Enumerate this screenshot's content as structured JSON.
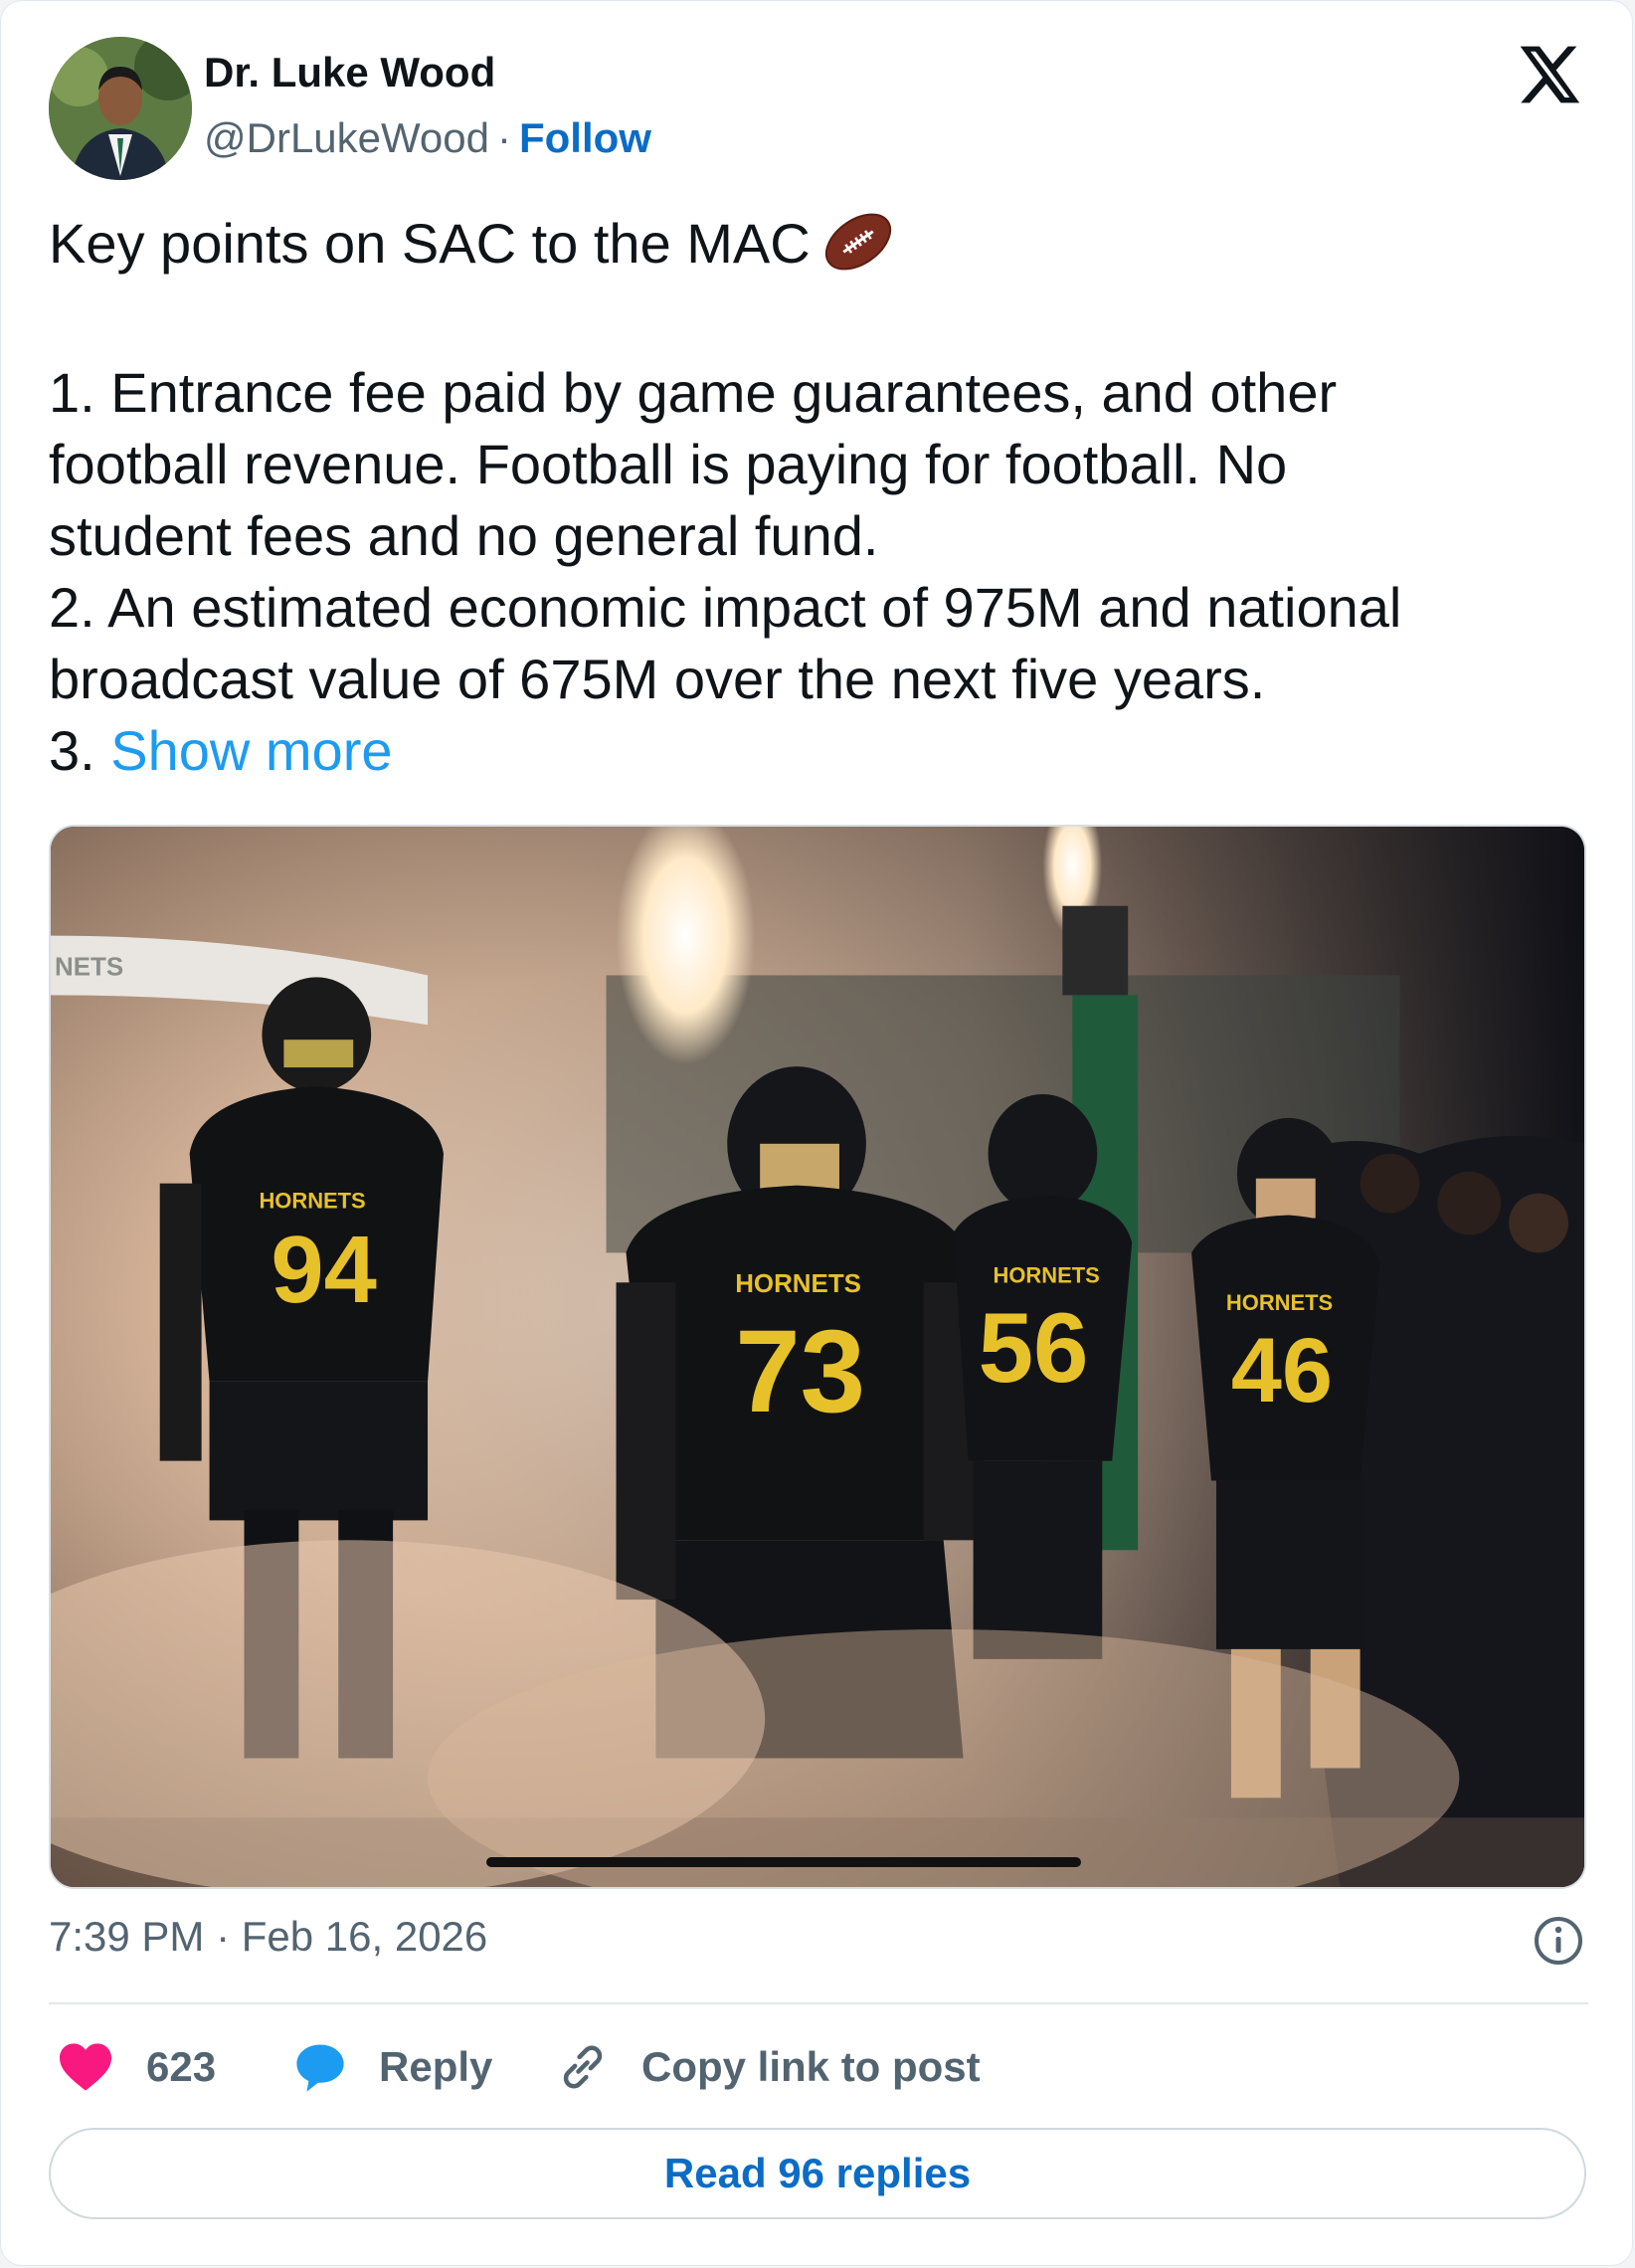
{
  "author": {
    "name": "Dr. Luke Wood",
    "handle": "@DrLukeWood",
    "separator": "·",
    "follow_label": "Follow"
  },
  "tweet": {
    "line1": "Key points on SAC to the MAC",
    "line2": "1. Entrance fee paid by game guarantees, and other",
    "line3": "football revenue. Football is paying for football. No",
    "line4": "student fees and no general fund.",
    "line5": "2. An estimated economic impact of 975M and national",
    "line6": "broadcast value of 675M over the next five years.",
    "line7_prefix": "3. ",
    "show_more": "Show more"
  },
  "media": {
    "banner_text": "NETS",
    "players": [
      {
        "team": "HORNETS",
        "number": "94"
      },
      {
        "team": "HORNETS",
        "number": "73"
      },
      {
        "team": "HORNETS",
        "number": "56"
      },
      {
        "team": "HORNETS",
        "number": "46"
      }
    ]
  },
  "meta": {
    "timestamp": "7:39 PM · Feb 16, 2026"
  },
  "actions": {
    "like_count": "623",
    "reply_label": "Reply",
    "copy_label": "Copy link to post"
  },
  "footer": {
    "read_replies": "Read 96 replies"
  },
  "colors": {
    "accent": "#0b6cc6",
    "link": "#1d9bf0",
    "like": "#f91880",
    "reply": "#1d9bf0",
    "jersey_number": "#e6c12a"
  }
}
